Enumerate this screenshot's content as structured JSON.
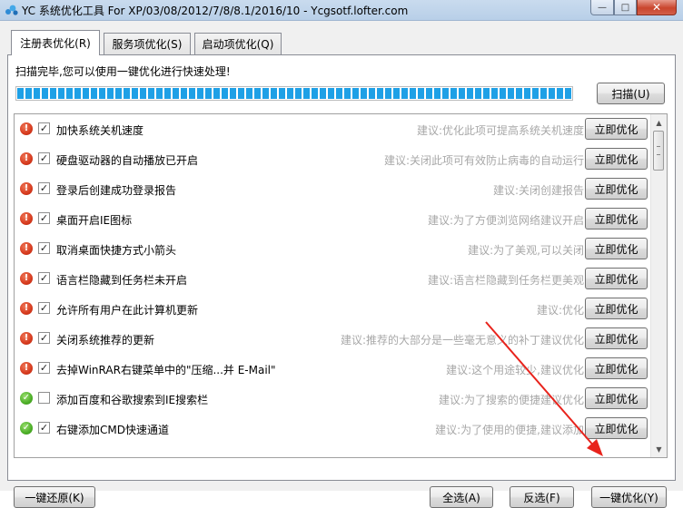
{
  "window": {
    "title": "YC 系统优化工具 For XP/03/08/2012/7/8/8.1/2016/10 - Ycgsotf.lofter.com",
    "icon": "app-leaf-icon",
    "controls": {
      "minimize": "—",
      "maximize": "□",
      "close": "✕"
    }
  },
  "tabs": [
    {
      "label": "注册表优化(R)",
      "active": true
    },
    {
      "label": "服务项优化(S)",
      "active": false
    },
    {
      "label": "启动项优化(Q)",
      "active": false
    }
  ],
  "status": {
    "text": "扫描完毕,您可以使用一键优化进行快速处理!",
    "progress_fraction": 1.0
  },
  "scan_button": "扫描(U)",
  "items": [
    {
      "status": "warning",
      "checked": true,
      "label": "加快系统关机速度",
      "hint": "建议:优化此项可提高系统关机速度",
      "button": "立即优化"
    },
    {
      "status": "warning",
      "checked": true,
      "label": "硬盘驱动器的自动播放已开启",
      "hint": "建议:关闭此项可有效防止病毒的自动运行",
      "button": "立即优化"
    },
    {
      "status": "warning",
      "checked": true,
      "label": "登录后创建成功登录报告",
      "hint": "建议:关闭创建报告",
      "button": "立即优化"
    },
    {
      "status": "warning",
      "checked": true,
      "label": "桌面开启IE图标",
      "hint": "建议:为了方便浏览网络建议开启",
      "button": "立即优化"
    },
    {
      "status": "warning",
      "checked": true,
      "label": "取消桌面快捷方式小箭头",
      "hint": "建议:为了美观,可以关闭",
      "button": "立即优化"
    },
    {
      "status": "warning",
      "checked": true,
      "label": "语言栏隐藏到任务栏未开启",
      "hint": "建议:语言栏隐藏到任务栏更美观",
      "button": "立即优化"
    },
    {
      "status": "warning",
      "checked": true,
      "label": "允许所有用户在此计算机更新",
      "hint": "建议:优化",
      "button": "立即优化"
    },
    {
      "status": "warning",
      "checked": true,
      "label": "关闭系统推荐的更新",
      "hint": "建议:推荐的大部分是一些毫无意义的补丁建议优化",
      "button": "立即优化"
    },
    {
      "status": "warning",
      "checked": true,
      "label": "去掉WinRAR右键菜单中的\"压缩...并 E-Mail\"",
      "hint": "建议:这个用途较少,建议优化",
      "button": "立即优化"
    },
    {
      "status": "ok",
      "checked": false,
      "label": "添加百度和谷歌搜索到IE搜索栏",
      "hint": "建议:为了搜索的便捷建议优化",
      "button": "立即优化"
    },
    {
      "status": "ok",
      "checked": true,
      "label": "右键添加CMD快速通道",
      "hint": "建议:为了使用的便捷,建议添加",
      "button": "立即优化"
    }
  ],
  "bottom": {
    "restore": "一键还原(K)",
    "select_all": "全选(A)",
    "invert": "反选(F)",
    "optimize": "一键优化(Y)"
  },
  "colors": {
    "progress": "#1ea0e6",
    "annotation_arrow": "#e8231c",
    "warning": "#d63a1e",
    "ok": "#4cae27"
  }
}
